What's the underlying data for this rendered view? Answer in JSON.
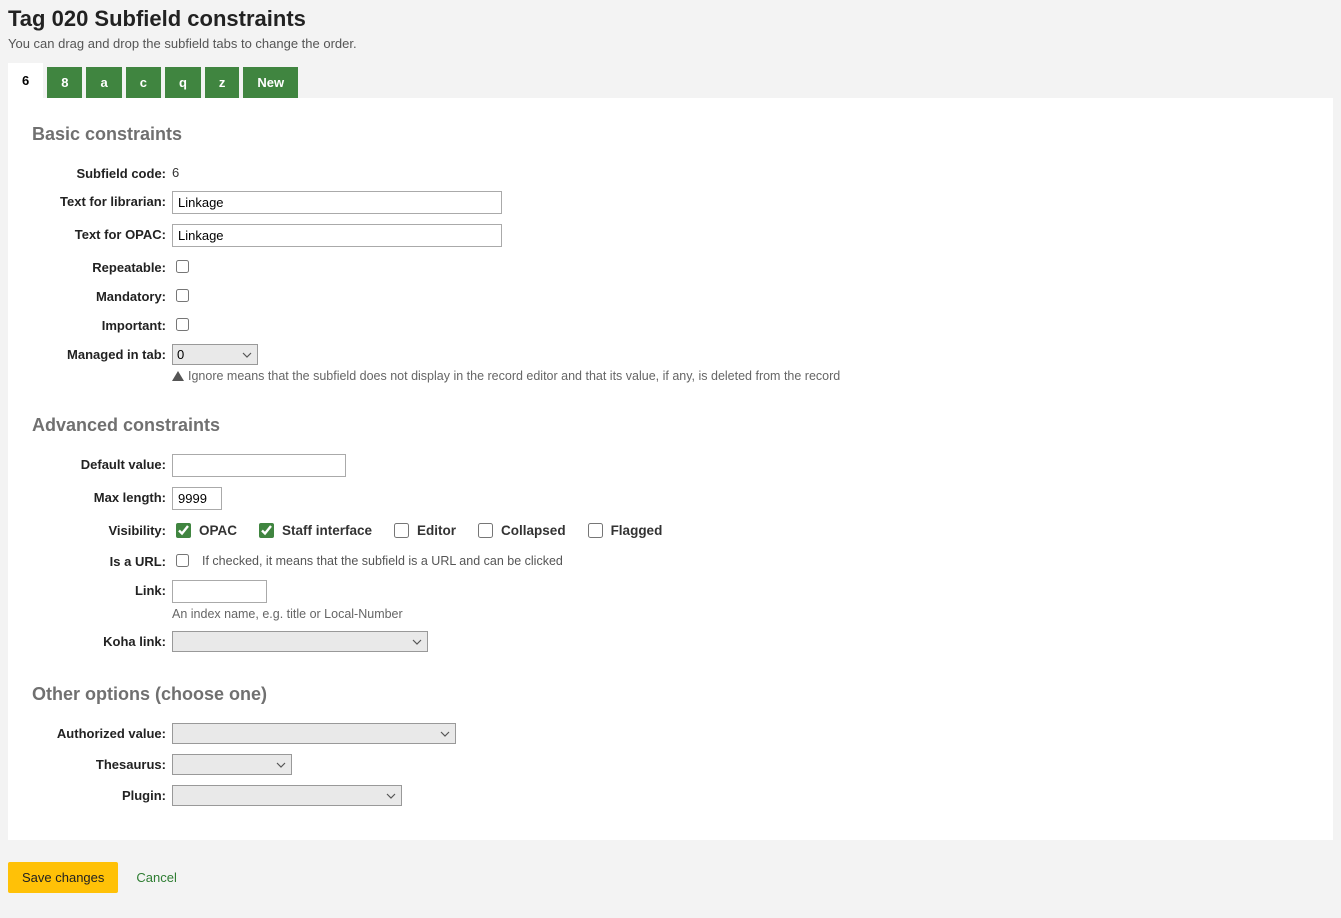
{
  "header": {
    "title": "Tag 020 Subfield constraints",
    "subtitle": "You can drag and drop the subfield tabs to change the order."
  },
  "tabs": [
    "6",
    "8",
    "a",
    "c",
    "q",
    "z",
    "New"
  ],
  "active_tab": "6",
  "sections": {
    "basic": "Basic constraints",
    "advanced": "Advanced constraints",
    "other": "Other options (choose one)"
  },
  "basic": {
    "subfield_code_label": "Subfield code:",
    "subfield_code_value": "6",
    "text_librarian_label": "Text for librarian:",
    "text_librarian_value": "Linkage",
    "text_opac_label": "Text for OPAC:",
    "text_opac_value": "Linkage",
    "repeatable_label": "Repeatable:",
    "repeatable_checked": false,
    "mandatory_label": "Mandatory:",
    "mandatory_checked": false,
    "important_label": "Important:",
    "important_checked": false,
    "managed_tab_label": "Managed in tab:",
    "managed_tab_value": "0",
    "managed_tab_hint": "Ignore means that the subfield does not display in the record editor and that its value, if any, is deleted from the record"
  },
  "advanced": {
    "default_value_label": "Default value:",
    "default_value": "",
    "max_length_label": "Max length:",
    "max_length_value": "9999",
    "visibility_label": "Visibility:",
    "visibility": {
      "opac": {
        "label": "OPAC",
        "checked": true
      },
      "staff": {
        "label": "Staff interface",
        "checked": true
      },
      "editor": {
        "label": "Editor",
        "checked": false
      },
      "collapsed": {
        "label": "Collapsed",
        "checked": false
      },
      "flagged": {
        "label": "Flagged",
        "checked": false
      }
    },
    "is_url_label": "Is a URL:",
    "is_url_checked": false,
    "is_url_hint": "If checked, it means that the subfield is a URL and can be clicked",
    "link_label": "Link:",
    "link_value": "",
    "link_hint": "An index name, e.g. title or Local-Number",
    "koha_link_label": "Koha link:",
    "koha_link_value": ""
  },
  "other": {
    "authorized_value_label": "Authorized value:",
    "authorized_value": "",
    "thesaurus_label": "Thesaurus:",
    "thesaurus_value": "",
    "plugin_label": "Plugin:",
    "plugin_value": ""
  },
  "footer": {
    "save_label": "Save changes",
    "cancel_label": "Cancel"
  }
}
